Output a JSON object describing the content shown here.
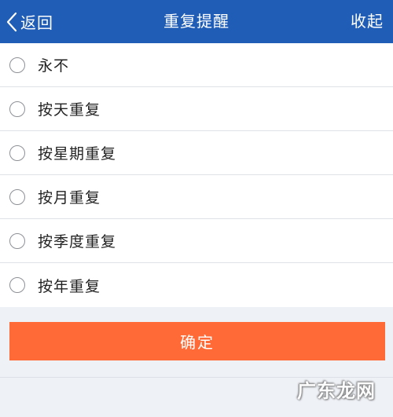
{
  "header": {
    "back_label": "返回",
    "title": "重复提醒",
    "collapse_label": "收起"
  },
  "options": [
    {
      "label": "永不",
      "selected": false
    },
    {
      "label": "按天重复",
      "selected": false
    },
    {
      "label": "按星期重复",
      "selected": false
    },
    {
      "label": "按月重复",
      "selected": false
    },
    {
      "label": "按季度重复",
      "selected": false
    },
    {
      "label": "按年重复",
      "selected": false
    }
  ],
  "footer": {
    "confirm_label": "确定"
  },
  "watermark": "广东龙网",
  "colors": {
    "header_bg": "#1f5db6",
    "confirm_bg": "#ff6a36",
    "page_bg": "#eef1f6"
  }
}
